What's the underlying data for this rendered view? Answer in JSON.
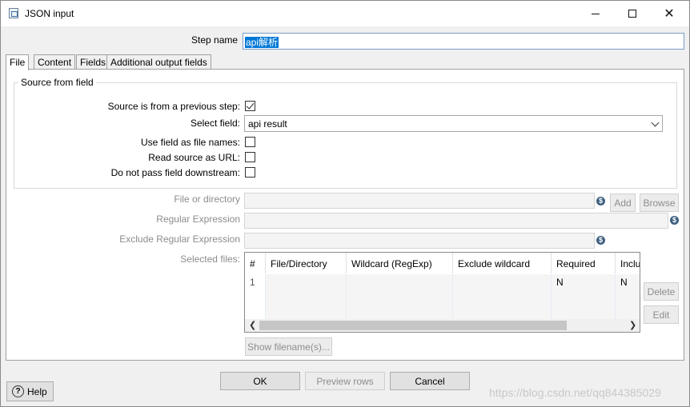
{
  "window": {
    "title": "JSON input"
  },
  "step": {
    "label": "Step name",
    "value": "api解析"
  },
  "tabs": [
    {
      "label": "File"
    },
    {
      "label": "Content"
    },
    {
      "label": "Fields"
    },
    {
      "label": "Additional output fields"
    }
  ],
  "source_group": {
    "title": "Source from field",
    "from_previous_label": "Source is from a previous step:",
    "from_previous_checked": true,
    "select_field_label": "Select field:",
    "select_field_value": "api result",
    "use_field_label": "Use field as file names:",
    "read_url_label": "Read source as URL:",
    "no_pass_label": "Do not pass field downstream:"
  },
  "file": {
    "file_dir_label": "File or directory",
    "regex_label": "Regular Expression",
    "exclude_regex_label": "Exclude Regular Expression",
    "selected_files_label": "Selected files:",
    "add_label": "Add",
    "browse_label": "Browse",
    "delete_label": "Delete",
    "edit_label": "Edit",
    "show_filenames_label": "Show filename(s)...",
    "variable_icon": "$"
  },
  "table": {
    "columns": [
      "#",
      "File/Directory",
      "Wildcard (RegExp)",
      "Exclude wildcard",
      "Required",
      "Inclu"
    ],
    "rows": [
      [
        "1",
        "",
        "",
        "",
        "N",
        "N"
      ]
    ]
  },
  "footer": {
    "ok_label": "OK",
    "preview_label": "Preview rows",
    "cancel_label": "Cancel",
    "help_label": "Help"
  },
  "watermark": "https://blog.csdn.net/qq844385029"
}
